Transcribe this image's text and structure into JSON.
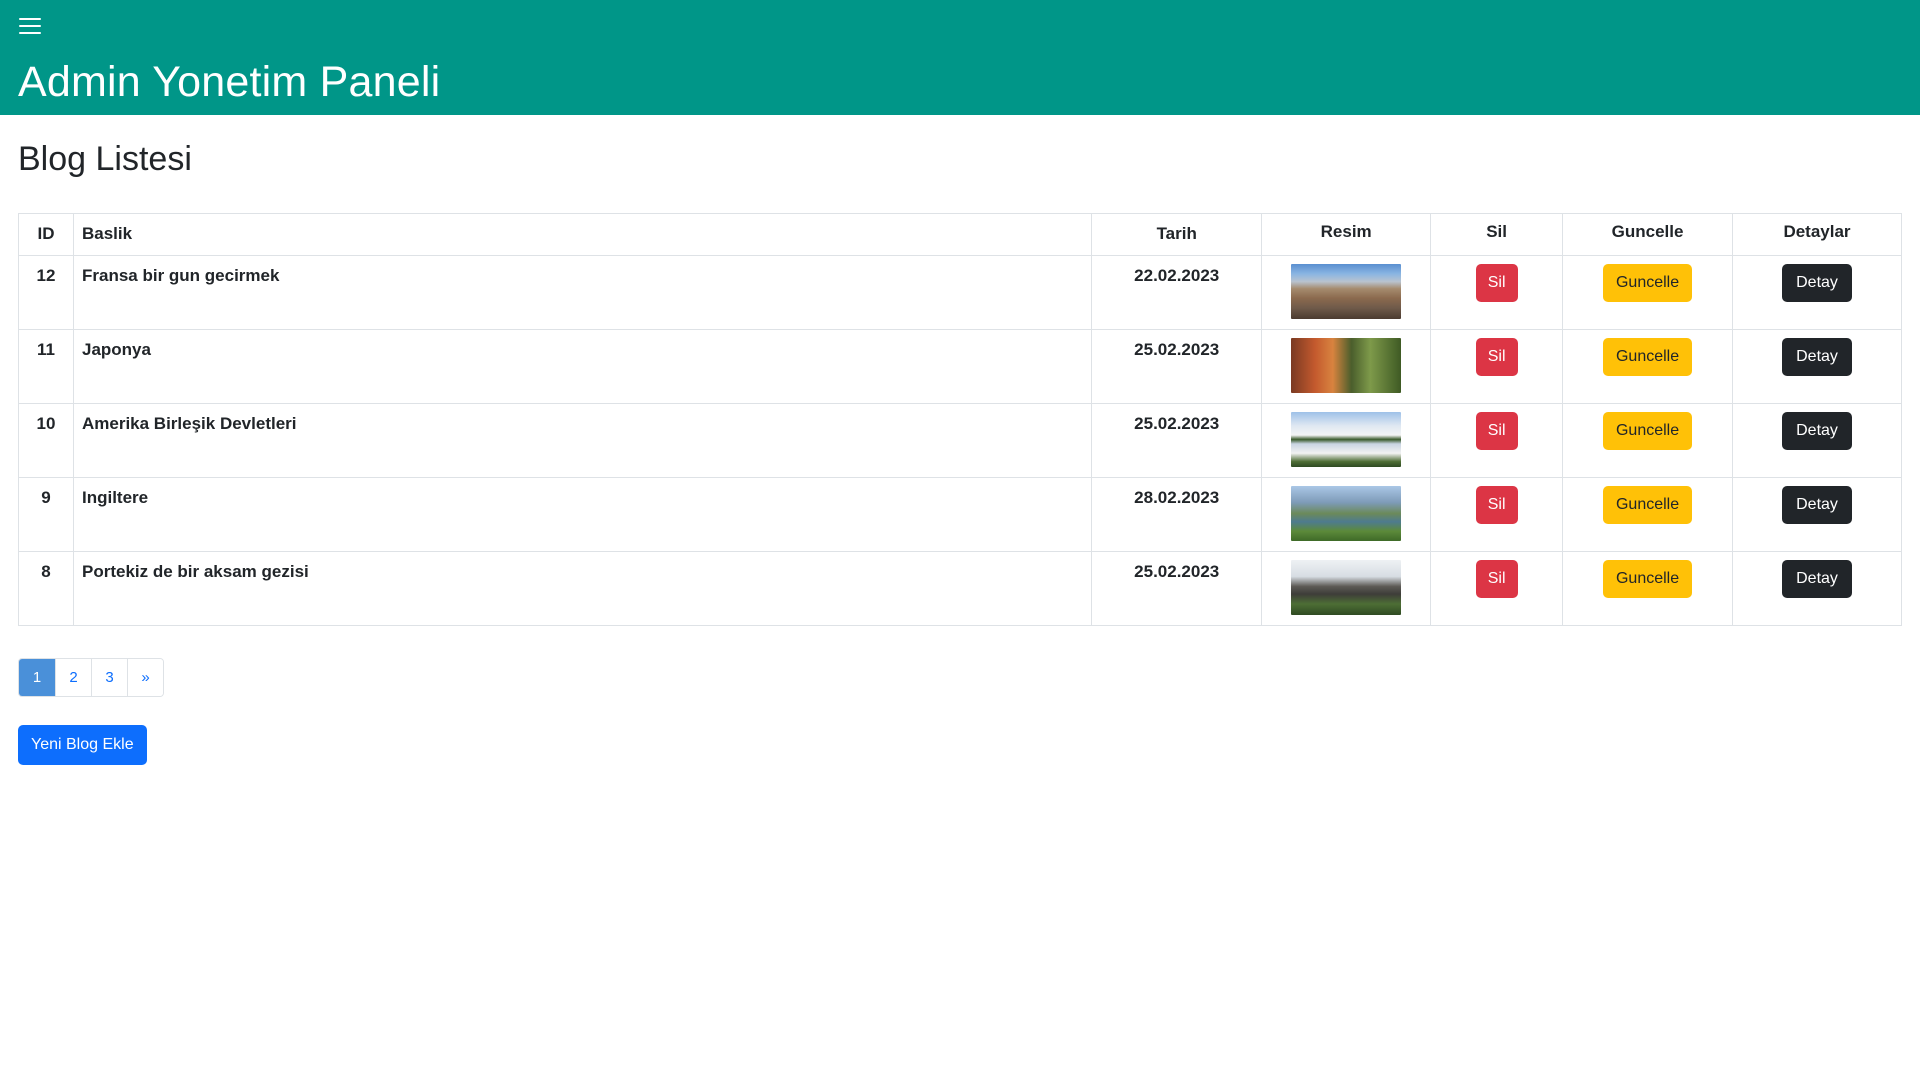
{
  "header": {
    "menu_icon": "hamburger-menu-icon",
    "title": "Admin Yonetim Paneli",
    "background_color": "#009688"
  },
  "page": {
    "title": "Blog Listesi"
  },
  "table": {
    "columns": [
      "ID",
      "Baslik",
      "Tarih",
      "Resim",
      "Sil",
      "Guncelle",
      "Detaylar"
    ],
    "rows": [
      {
        "id": "12",
        "title": "Fransa bir gun gecirmek",
        "date": "22.02.2023",
        "image": "paris-cityscape-thumbnail",
        "delete_label": "Sil",
        "update_label": "Guncelle",
        "detail_label": "Detay"
      },
      {
        "id": "11",
        "title": "Japonya",
        "date": "25.02.2023",
        "image": "japan-autumn-garden-thumbnail",
        "delete_label": "Sil",
        "update_label": "Guncelle",
        "detail_label": "Detay"
      },
      {
        "id": "10",
        "title": "Amerika Birleşik Devletleri",
        "date": "25.02.2023",
        "image": "white-house-thumbnail",
        "delete_label": "Sil",
        "update_label": "Guncelle",
        "detail_label": "Detay"
      },
      {
        "id": "9",
        "title": "Ingiltere",
        "date": "28.02.2023",
        "image": "england-lake-landscape-thumbnail",
        "delete_label": "Sil",
        "update_label": "Guncelle",
        "detail_label": "Detay"
      },
      {
        "id": "8",
        "title": "Portekiz de bir aksam gezisi",
        "date": "25.02.2023",
        "image": "portugal-castle-thumbnail",
        "delete_label": "Sil",
        "update_label": "Guncelle",
        "detail_label": "Detay"
      }
    ]
  },
  "pagination": {
    "pages": [
      "1",
      "2",
      "3"
    ],
    "next": "»",
    "active_page": "1"
  },
  "actions": {
    "add_blog_label": "Yeni Blog Ekle"
  },
  "colors": {
    "danger": "#dc3545",
    "warning": "#ffc107",
    "dark": "#212529",
    "primary": "#0d6efd"
  }
}
